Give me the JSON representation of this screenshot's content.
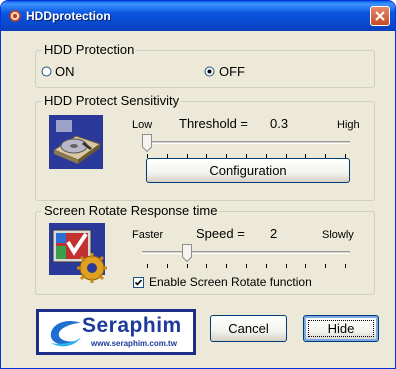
{
  "window": {
    "title": "HDDprotection"
  },
  "hdd_protection": {
    "group_label": "HDD Protection",
    "on_label": "ON",
    "off_label": "OFF",
    "selected": "OFF"
  },
  "sensitivity": {
    "group_label": "HDD Protect Sensitivity",
    "low_label": "Low",
    "high_label": "High",
    "threshold_label": "Threshold =",
    "threshold_value": "0.3",
    "slider_fraction": 0.0,
    "configuration_button": "Configuration"
  },
  "rotate": {
    "group_label": "Screen Rotate Response time",
    "faster_label": "Faster",
    "slowly_label": "Slowly",
    "speed_label": "Speed =",
    "speed_value": "2",
    "slider_fraction": 0.2,
    "enable_label": "Enable Screen Rotate function",
    "enable_checked": true
  },
  "logo": {
    "brand": "Seraphim",
    "url": "www.seraphim.com.tw"
  },
  "buttons": {
    "cancel": "Cancel",
    "hide": "Hide"
  }
}
